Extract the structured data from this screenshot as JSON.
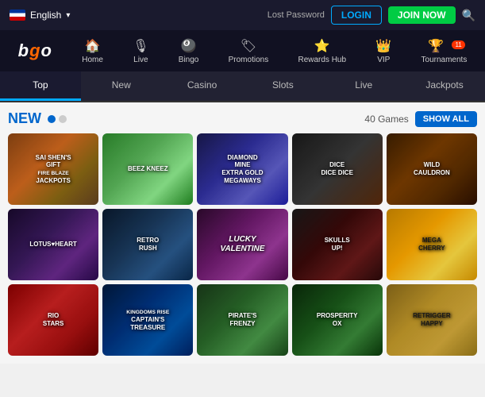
{
  "header": {
    "language": "English",
    "lost_password": "Lost Password",
    "login_label": "LOGIN",
    "join_label": "JOIN NOW"
  },
  "nav": {
    "logo": "bgo",
    "items": [
      {
        "id": "home",
        "label": "Home",
        "icon": "🏠"
      },
      {
        "id": "live",
        "label": "Live",
        "icon": "🎙"
      },
      {
        "id": "bingo",
        "label": "Bingo",
        "icon": "🎱"
      },
      {
        "id": "promotions",
        "label": "Promotions",
        "icon": "🏷"
      },
      {
        "id": "rewards",
        "label": "Rewards Hub",
        "icon": "⭐"
      },
      {
        "id": "vip",
        "label": "VIP",
        "icon": "👑"
      },
      {
        "id": "tournaments",
        "label": "Tournaments",
        "icon": "🏆",
        "badge": "11"
      }
    ]
  },
  "tabs": [
    {
      "id": "top",
      "label": "Top",
      "active": true
    },
    {
      "id": "new",
      "label": "New",
      "active": false
    },
    {
      "id": "casino",
      "label": "Casino",
      "active": false
    },
    {
      "id": "slots",
      "label": "Slots",
      "active": false
    },
    {
      "id": "live",
      "label": "Live",
      "active": false
    },
    {
      "id": "jackpots",
      "label": "Jackpots",
      "active": false
    }
  ],
  "section": {
    "title": "NEW",
    "games_count": "40 Games",
    "show_all_label": "SHOW ALL"
  },
  "games": [
    {
      "id": "sai",
      "title": "Sai Shen's Gift\nFire Blaze\nJackpots",
      "style": "tile-sai"
    },
    {
      "id": "beez",
      "title": "Beez Kneez",
      "style": "tile-beez"
    },
    {
      "id": "diamond",
      "title": "Diamond\nMine\nExtra Gold\nMEGAWAYS",
      "style": "tile-diamond"
    },
    {
      "id": "dice",
      "title": "Dice\nDice Dice",
      "style": "tile-dice"
    },
    {
      "id": "wild",
      "title": "Wild\nCauldron",
      "style": "tile-wild"
    },
    {
      "id": "lotus",
      "title": "Lotus♥Heart",
      "style": "tile-lotus"
    },
    {
      "id": "retro",
      "title": "Retro\nRush",
      "style": "tile-retro"
    },
    {
      "id": "lucky",
      "title": "Lucky\nValentine",
      "style": "tile-lucky"
    },
    {
      "id": "skulls",
      "title": "Skulls\nUP!",
      "style": "tile-skulls"
    },
    {
      "id": "mega",
      "title": "Mega\nCherry",
      "style": "tile-mega"
    },
    {
      "id": "rio",
      "title": "Rio\nStars",
      "style": "tile-rio"
    },
    {
      "id": "captain",
      "title": "Kingdoms Rise\nCaptain's\nTreasure",
      "style": "tile-captain"
    },
    {
      "id": "pirates",
      "title": "Pirate's\nFrenzy",
      "style": "tile-pirates"
    },
    {
      "id": "prosperity",
      "title": "Prosperity\nOx",
      "style": "tile-prosperity"
    },
    {
      "id": "retrigger",
      "title": "Retrigger\nHappy",
      "style": "tile-retrigger"
    }
  ]
}
